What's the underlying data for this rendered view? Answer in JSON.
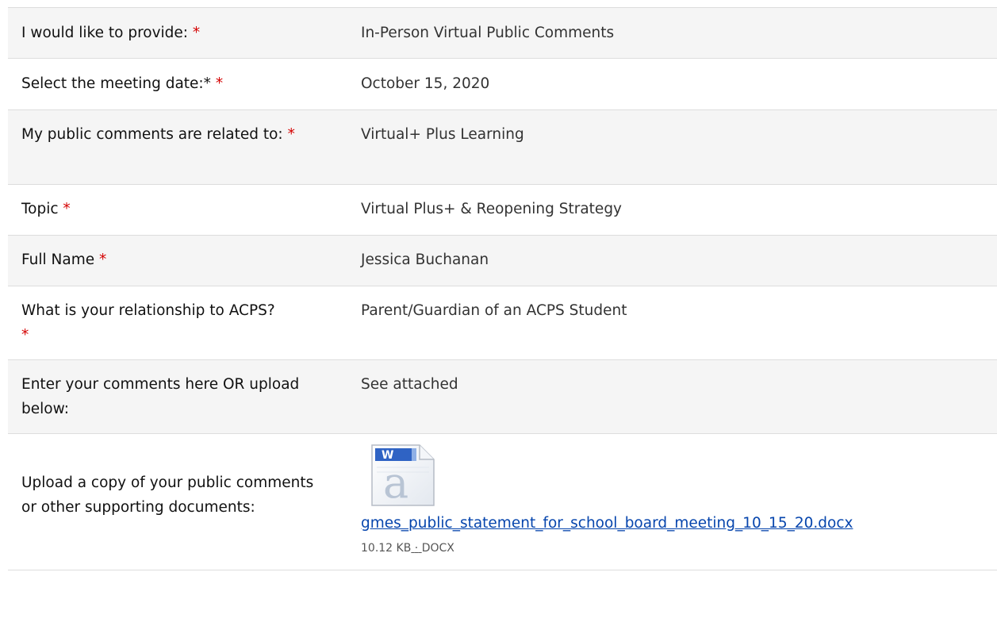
{
  "required_mark": "*",
  "fields": [
    {
      "label": "I would like to provide:",
      "value": "In-Person Virtual Public Comments"
    },
    {
      "label": "Select the meeting date:*",
      "value": "October 15, 2020"
    },
    {
      "label": "My public comments are related to:",
      "value": "Virtual+ Plus Learning"
    },
    {
      "label": "Topic",
      "value": "Virtual Plus+ & Reopening Strategy"
    },
    {
      "label": "Full Name",
      "value": "Jessica Buchanan"
    },
    {
      "label": "What is your relationship to ACPS?",
      "value": "Parent/Guardian of an ACPS Student"
    },
    {
      "label": "Enter your comments here OR upload below:",
      "value": "See attached"
    }
  ],
  "upload": {
    "label": "Upload a copy of your public comments or other supporting documents:",
    "icon": "word-document-icon",
    "file_name": "gmes_public_statement_for_school_board_meeting_10_15_20.docx",
    "file_size": "10.12 KB",
    "separator": "·",
    "file_type": "DOCX"
  }
}
